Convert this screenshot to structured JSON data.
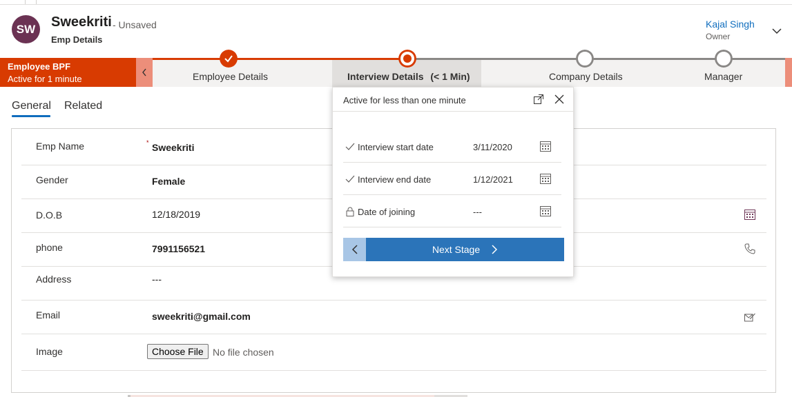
{
  "header": {
    "avatar_initials": "SW",
    "record_name": "Sweekriti",
    "record_status": "- Unsaved",
    "form_name": "Emp Details",
    "owner_name": "Kajal Singh",
    "owner_label": "Owner",
    "chevron_icon": "chevron-down-icon"
  },
  "bpf": {
    "process_name": "Employee BPF",
    "active_duration": "Active for 1 minute",
    "accent_color": "#d83b01",
    "stages": [
      {
        "label": "Employee Details",
        "state": "completed"
      },
      {
        "label": "Interview Details",
        "duration": "(< 1 Min)",
        "state": "active"
      },
      {
        "label": "Company Details",
        "state": "pending"
      },
      {
        "label": "Manager",
        "state": "pending"
      }
    ]
  },
  "tabs": [
    {
      "label": "General",
      "selected": true
    },
    {
      "label": "Related",
      "selected": false
    }
  ],
  "form": {
    "fields": [
      {
        "label": "Emp Name",
        "value": "Sweekriti",
        "required": "*"
      },
      {
        "label": "Gender",
        "value": "Female"
      },
      {
        "label": "D.O.B",
        "value": "12/18/2019",
        "icon": "calendar-icon"
      },
      {
        "label": "phone",
        "value": "7991156521",
        "icon": "phone-icon"
      },
      {
        "label": "Address",
        "value": "---"
      },
      {
        "label": "Email",
        "value": "sweekriti@gmail.com",
        "icon": "email-icon"
      },
      {
        "label": "Image",
        "button": "Choose File",
        "value": "No file chosen"
      }
    ]
  },
  "flyout": {
    "header": "Active for less than one minute",
    "rows": [
      {
        "label": "Interview start date",
        "value": "3/11/2020",
        "state_icon": "check-icon"
      },
      {
        "label": "Interview end date",
        "value": "1/12/2021",
        "state_icon": "check-icon"
      },
      {
        "label": "Date of joining",
        "value": "---",
        "state_icon": "lock-icon"
      }
    ],
    "next_label": "Next Stage"
  }
}
